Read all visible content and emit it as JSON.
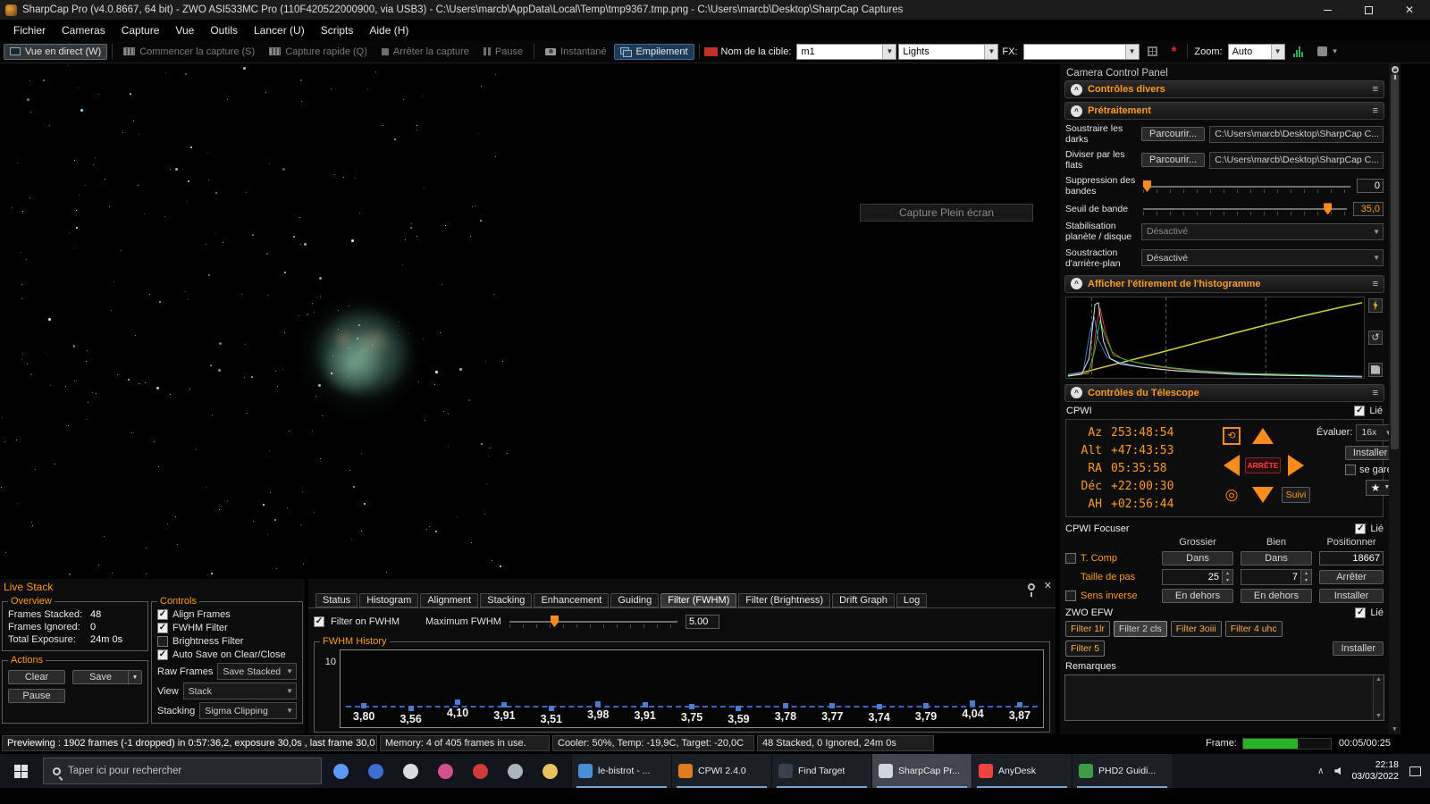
{
  "colors": {
    "accent": "#ff9c1e",
    "stack_active": "#1d3a56",
    "progress_green": "#28b428",
    "fwhm_line": "#3a66c8"
  },
  "window": {
    "title": "SharpCap Pro (v4.0.8667, 64 bit) - ZWO ASI533MC Pro (110F420522000900, via USB3) - C:\\Users\\marcb\\AppData\\Local\\Temp\\tmp9367.tmp.png - C:\\Users\\marcb\\Desktop\\SharpCap Captures"
  },
  "menu": {
    "items": [
      "Fichier",
      "Cameras",
      "Capture",
      "Vue",
      "Outils",
      "Lancer (U)",
      "Scripts",
      "Aide (H)"
    ]
  },
  "toolbar": {
    "live_view": "Vue en direct (W)",
    "start_capture": "Commencer la capture (S)",
    "quick_capture": "Capture rapide (Q)",
    "stop_capture": "Arrêter la capture",
    "pause": "Pause",
    "snapshot": "Instantané",
    "stack": "Empilement",
    "target_label": "Nom de la cible:",
    "target_value": "m1",
    "frame_type_value": "Lights",
    "fx_label": "FX:",
    "zoom_label": "Zoom:",
    "zoom_value": "Auto"
  },
  "image_area": {
    "fullscreen_button": "Capture Plein écran"
  },
  "camera_panel": {
    "title": "Camera Control Panel",
    "misc_title": "Contrôles divers",
    "pretraitement": {
      "title": "Prétraitement",
      "darks_label": "Soustraire les darks",
      "flats_label": "Diviser par les flats",
      "browse_label": "Parcourir...",
      "darks_path": "C:\\Users\\marcb\\Desktop\\SharpCap C...",
      "flats_path": "C:\\Users\\marcb\\Desktop\\SharpCap C...",
      "banding_label": "Suppression des bandes",
      "banding_value": "0",
      "threshold_label": "Seuil de bande",
      "threshold_value": "35,0",
      "stabilization_label": "Stabilisation planète / disque",
      "stabilization_value": "Désactivé",
      "background_label": "Soustraction d'arrière-plan",
      "background_value": "Désactivé"
    },
    "histogram_title": "Afficher l'étirement de l'histogramme",
    "telescope": {
      "title": "Contrôles du Télescope",
      "device": "CPWI",
      "linked_label": "Lié",
      "coords": [
        {
          "label": "Az",
          "value": "253:48:54"
        },
        {
          "label": "Alt",
          "value": "+47:43:53"
        },
        {
          "label": "RA",
          "value": "05:35:58"
        },
        {
          "label": "Déc",
          "value": "+22:00:30"
        },
        {
          "label": "AH",
          "value": "+02:56:44"
        }
      ],
      "stop_label": "ARRÊTE",
      "rate_label": "Évaluer:",
      "rate_value": "16x",
      "install_label": "Installer",
      "park_label": "se garer",
      "tracking_label": "Suivi"
    },
    "focuser": {
      "title": "CPWI Focuser",
      "linked_label": "Lié",
      "columns": [
        "Grossier",
        "Bien",
        "Positionner"
      ],
      "rows": [
        {
          "label": "T. Comp",
          "coarse": "Dans",
          "fine": "Dans",
          "position": "18667"
        },
        {
          "label": "Taille de pas",
          "coarse": "25",
          "fine": "7",
          "position": "Arrêter"
        },
        {
          "label": "Sens inverse",
          "coarse": "En dehors",
          "fine": "En dehors",
          "position": "Installer"
        }
      ]
    },
    "efw": {
      "title": "ZWO EFW",
      "linked_label": "Lié",
      "filters": [
        "Filter 1lr",
        "Filter 2 cls",
        "Filter 3oiii",
        "Filter 4 uhc",
        "Filter 5"
      ],
      "selected_filter": "Filter 2 cls",
      "install_label": "Installer"
    },
    "remarks_title": "Remarques"
  },
  "livestack": {
    "title": "Live Stack",
    "overview": {
      "title": "Overview",
      "frames_stacked_label": "Frames Stacked:",
      "frames_stacked": "48",
      "frames_ignored_label": "Frames Ignored:",
      "frames_ignored": "0",
      "total_exposure_label": "Total Exposure:",
      "total_exposure": "24m 0s"
    },
    "actions": {
      "title": "Actions",
      "clear": "Clear",
      "save": "Save",
      "pause": "Pause"
    },
    "controls": {
      "title": "Controls",
      "align_frames": "Align Frames",
      "fwhm_filter": "FWHM Filter",
      "brightness_filter": "Brightness Filter",
      "auto_save": "Auto Save on Clear/Close",
      "raw_frames_label": "Raw Frames",
      "raw_frames_value": "Save Stacked",
      "view_label": "View",
      "view_value": "Stack",
      "stacking_label": "Stacking",
      "stacking_value": "Sigma Clipping"
    },
    "tabs": [
      "Status",
      "Histogram",
      "Alignment",
      "Stacking",
      "Enhancement",
      "Guiding",
      "Filter (FWHM)",
      "Filter (Brightness)",
      "Drift Graph",
      "Log"
    ],
    "active_tab": "Filter (FWHM)",
    "filter_on_fwhm": "Filter on FWHM",
    "max_fwhm_label": "Maximum FWHM",
    "max_fwhm_value": "5.00",
    "history_title": "FWHM History",
    "y_tick": "10",
    "history_values": [
      "3,80",
      "3,56",
      "4,10",
      "3,91",
      "3,51",
      "3,98",
      "3,91",
      "3,75",
      "3,59",
      "3,78",
      "3,77",
      "3,74",
      "3,79",
      "4,04",
      "3,87"
    ]
  },
  "statusbar": {
    "segments": [
      "Previewing : 1902 frames (-1 dropped) in 0:57:36,2, exposure 30,0s , last frame 30,0",
      "Memory: 4 of 405 frames in use.",
      "Cooler: 50%, Temp: -19,9C, Target: -20,0C",
      "48 Stacked, 0 Ignored, 24m 0s"
    ],
    "frame_label": "Frame:",
    "progress_pct": 62,
    "time": "00:05/00:25"
  },
  "taskbar": {
    "search_placeholder": "Taper ici pour rechercher",
    "quick_icons": [
      {
        "name": "chrome-icon",
        "color": "#5b9bf8"
      },
      {
        "name": "mail-icon",
        "color": "#3b6fd4"
      },
      {
        "name": "copernic-icon",
        "color": "#d8dde2"
      },
      {
        "name": "photos-icon",
        "color": "#d44f8e"
      },
      {
        "name": "jdownloader-icon",
        "color": "#d23b3b"
      },
      {
        "name": "stellarium-icon",
        "color": "#aab4bf"
      },
      {
        "name": "explorer-icon",
        "color": "#e8c35a"
      }
    ],
    "apps": [
      {
        "label": "le-bistrot - ...",
        "color": "#4a90d9",
        "active": false
      },
      {
        "label": "CPWI 2.4.0",
        "color": "#e07b20",
        "active": false
      },
      {
        "label": "Find Target",
        "color": "#39414f",
        "active": false
      },
      {
        "label": "SharpCap Pr...",
        "color": "#cfd6dd",
        "active": true
      },
      {
        "label": "AnyDesk",
        "color": "#ef443b",
        "active": false
      },
      {
        "label": "PHD2 Guidi...",
        "color": "#3f9c46",
        "active": false
      }
    ],
    "tray_time": "22:18",
    "tray_date": "03/03/2022"
  }
}
